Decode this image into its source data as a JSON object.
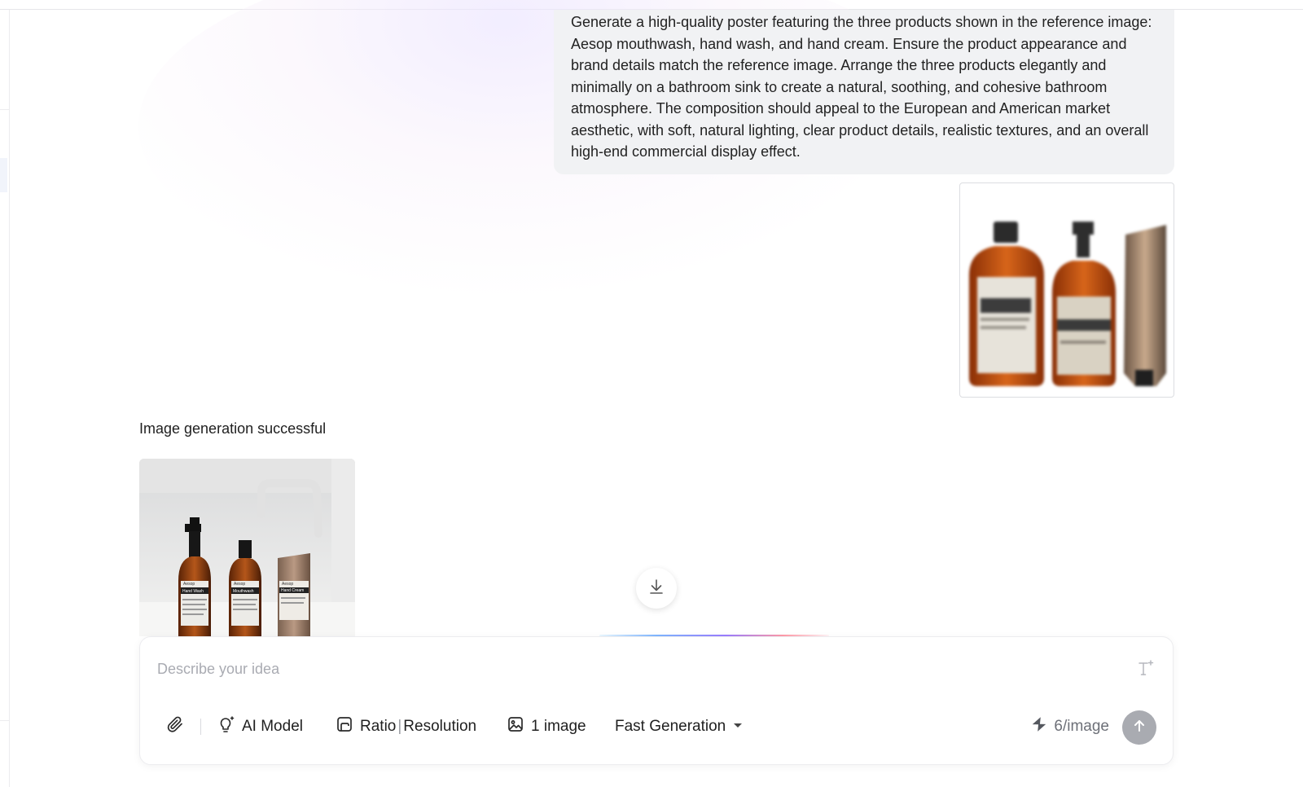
{
  "conversation": {
    "prompt_text": "Generate a high-quality poster featuring the three products shown in the reference image: Aesop mouthwash, hand wash, and hand cream. Ensure the product appearance and brand details match the reference image. Arrange the three products elegantly and minimally on a bathroom sink to create a natural, soothing, and cohesive bathroom atmosphere. The composition should appeal to the European and American market aesthetic, with soft, natural lighting, clear product details, realistic textures, and an overall high-end commercial display effect.",
    "reference_label": "Aesop",
    "status_text": "Image generation successful",
    "result_labels": [
      "Aesop",
      "Hand Wash",
      "Mouthwash",
      "Hand Cream"
    ]
  },
  "composer": {
    "placeholder": "Describe your idea",
    "model_label": "AI Model",
    "ratio_label": "Ratio",
    "resolution_label": "Resolution",
    "ratio_separator": "|",
    "image_count_label": "1 image",
    "speed_label": "Fast Generation",
    "credits_label": "6/image"
  },
  "colors": {
    "accent_gray": "#a9abb1",
    "bubble_bg": "#f1f2f4",
    "amber_bottle": "#b8500f"
  },
  "icons": [
    "paperclip-icon",
    "bulb-icon",
    "ratio-icon",
    "image-icon",
    "caret-down-icon",
    "sparkle-icon",
    "arrow-up-icon",
    "download-icon",
    "text-style-icon"
  ]
}
